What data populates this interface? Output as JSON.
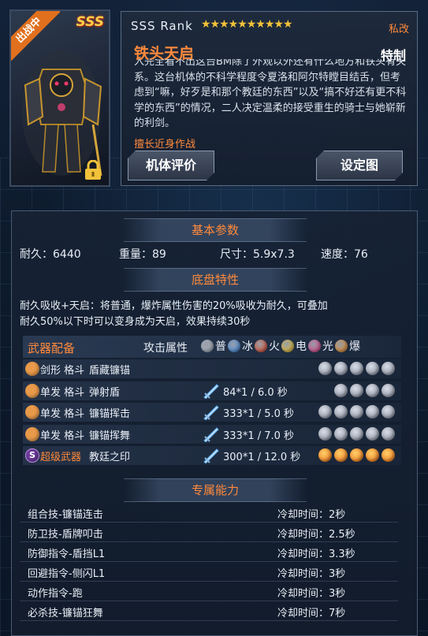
{
  "header": {
    "deploy_tag": "出战中",
    "rank_badge": "SSS",
    "rank_line": "SSS Rank",
    "stars": "★★★★★★★★★★",
    "private_label": "私改",
    "mech_name": "铁头天启",
    "mech_class": "特制",
    "description": "入完全看不出这台BM除了外观以外还有什么地方和铁头有关系。这台机体的不科学程度令夏洛和阿尔特瞠目结舌，但考虑到“嘛，好歹是和那个教廷的东西”以及“搞不好还有更不科学的东西”的情况，二人决定温柔的接受重生的骑士与她崭新的利剑。",
    "specialty": "擅长近身作战",
    "eval_button": "机体评价",
    "setting_button": "设定图"
  },
  "basic": {
    "title": "基本参数",
    "durability": "耐久：6440",
    "weight": "重量：89",
    "size": "尺寸：5.9x7.3",
    "speed": "速度：76"
  },
  "chassis": {
    "title": "底盘特性",
    "line1": "耐久吸收+天启：将普通，爆炸属性伤害的20%吸收为耐久，可叠加",
    "line2": "耐久50%以下时可以变身成为天启，效果持续30秒"
  },
  "weapons": {
    "title": "武器配备",
    "attr_label": "攻击属性",
    "attributes": [
      {
        "name": "普",
        "color": "#a8b0bc"
      },
      {
        "name": "冰",
        "color": "#3a8ae8"
      },
      {
        "name": "火",
        "color": "#e8421e"
      },
      {
        "name": "电",
        "color": "#f2c21a"
      },
      {
        "name": "光",
        "color": "#e83a8a"
      },
      {
        "name": "爆",
        "color": "#f08a1a"
      }
    ],
    "rows": [
      {
        "type": "剑形 格斗",
        "name": "盾藏镰锚",
        "damage": "",
        "elements": [
          "normal",
          "normal",
          "normal",
          "normal",
          "normal"
        ],
        "super": false,
        "sword": false
      },
      {
        "type": "单发 格斗",
        "name": "弹射盾",
        "damage": "84*1 / 6.0 秒",
        "elements": [
          "normal",
          "normal",
          "normal",
          "normal"
        ],
        "super": false,
        "sword": true
      },
      {
        "type": "单发 格斗",
        "name": "镰锚挥击",
        "damage": "333*1 / 5.0 秒",
        "elements": [
          "normal",
          "normal",
          "normal",
          "normal",
          "normal"
        ],
        "super": false,
        "sword": true
      },
      {
        "type": "单发 格斗",
        "name": "镰锚挥舞",
        "damage": "333*1 / 7.0 秒",
        "elements": [
          "normal",
          "normal",
          "normal",
          "normal",
          "normal"
        ],
        "super": false,
        "sword": true
      },
      {
        "type": "超级武器",
        "name": "教廷之印",
        "damage": "300*1 / 12.0 秒",
        "elements": [
          "fire",
          "fire",
          "fire",
          "fire",
          "fire"
        ],
        "super": true,
        "sword": true
      }
    ]
  },
  "abilities": {
    "title": "专属能力",
    "rows": [
      {
        "name": "组合技-镰锚连击",
        "cooldown": "冷却时间：2秒"
      },
      {
        "name": "防卫技-盾牌叩击",
        "cooldown": "冷却时间：2.5秒"
      },
      {
        "name": "防御指令-盾挡L1",
        "cooldown": "冷却时间：3.3秒"
      },
      {
        "name": "回避指令-侧闪L1",
        "cooldown": "冷却时间：3秒"
      },
      {
        "name": "动作指令-跑",
        "cooldown": "冷却时间：3秒"
      },
      {
        "name": "必杀技-镰锚狂舞",
        "cooldown": "冷却时间：7秒"
      }
    ]
  },
  "icons": {
    "lock": "lock-icon",
    "weapon": "weapon-type-icon",
    "super": "super-weapon-icon",
    "sword": "sword-icon"
  }
}
